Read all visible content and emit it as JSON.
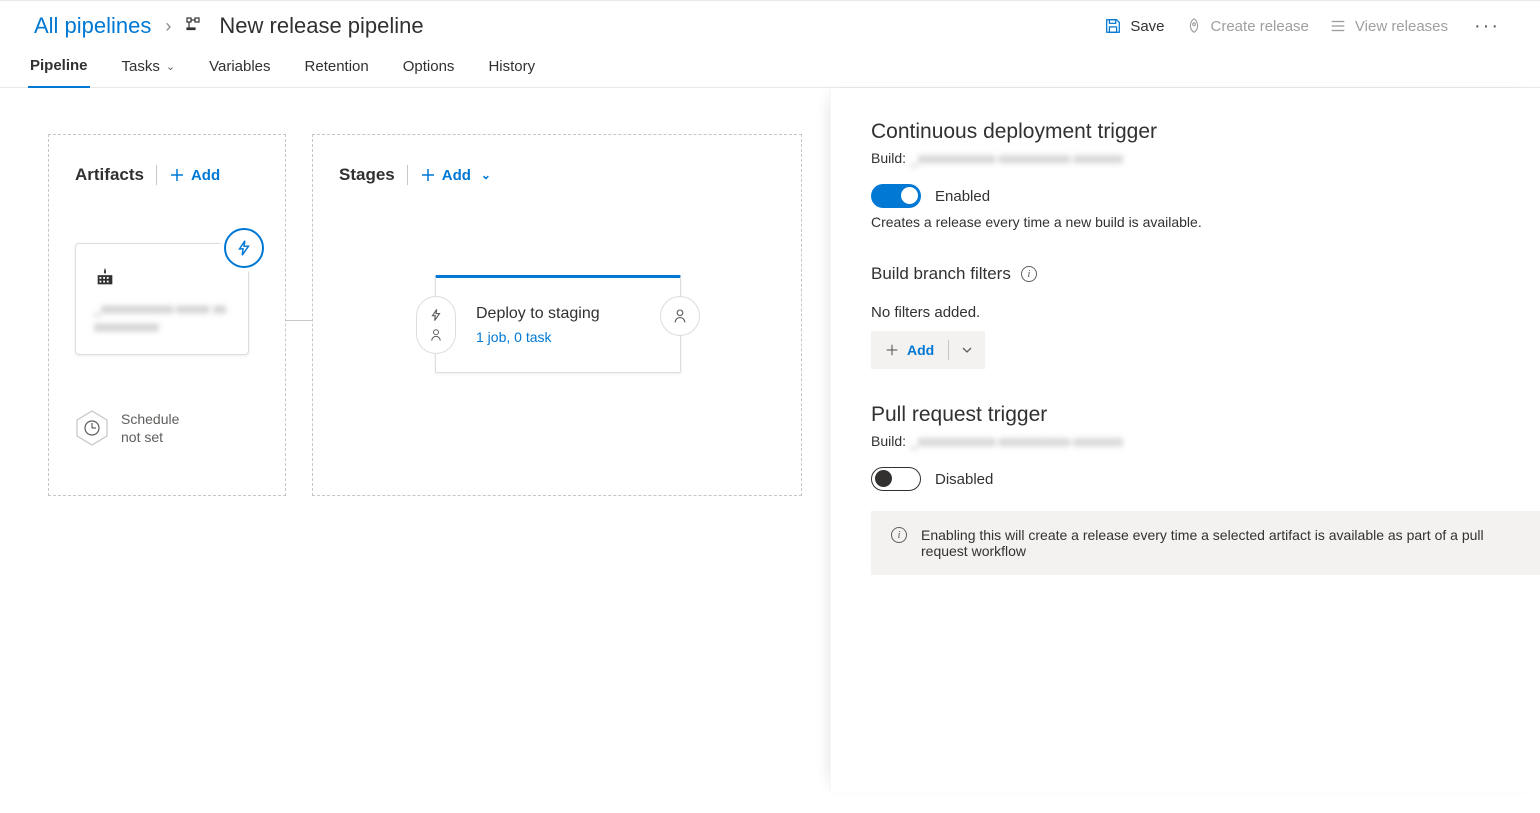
{
  "breadcrumb": {
    "all_pipelines": "All pipelines",
    "title": "New release pipeline"
  },
  "actions": {
    "save": "Save",
    "create_release": "Create release",
    "view_releases": "View releases"
  },
  "tabs": {
    "pipeline": "Pipeline",
    "tasks": "Tasks",
    "variables": "Variables",
    "retention": "Retention",
    "options": "Options",
    "history": "History"
  },
  "artifacts": {
    "title": "Artifacts",
    "add": "Add",
    "source_redacted": "_xxxxxxxxxxx-xxxxx xxxxxxxxxxxx",
    "schedule_label": "Schedule\nnot set"
  },
  "stages": {
    "title": "Stages",
    "add": "Add",
    "stage_name": "Deploy to staging",
    "stage_meta": "1 job, 0 task"
  },
  "panel": {
    "cd_title": "Continuous deployment trigger",
    "build_label": "Build:",
    "build_value_redacted": "_xxxxxxxxxxx-xxxxxxxxxx-xxxxxxx",
    "enabled": "Enabled",
    "enabled_desc": "Creates a release every time a new build is available.",
    "branch_filters_title": "Build branch filters",
    "no_filters": "No filters added.",
    "add": "Add",
    "pr_title": "Pull request trigger",
    "disabled": "Disabled",
    "pr_notice": "Enabling this will create a release every time a selected artifact is available as part of a pull request workflow"
  }
}
